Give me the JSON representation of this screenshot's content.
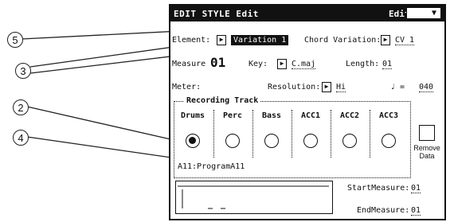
{
  "callouts": [
    "5",
    "3",
    "2",
    "4"
  ],
  "window": {
    "title": "EDIT STYLE Edit",
    "mode_label": "Edit",
    "menu_glyph": "▼"
  },
  "element": {
    "label": "Element:",
    "value": "Variation 1"
  },
  "chord_variation": {
    "label": "Chord Variation:",
    "value": "CV 1"
  },
  "measure": {
    "label": "Measure",
    "value": "01"
  },
  "key": {
    "label": "Key:",
    "value": "C.maj"
  },
  "length": {
    "label": "Length:",
    "value": "01"
  },
  "meter": {
    "label": "Meter:",
    "value": "**/**"
  },
  "resolution": {
    "label": "Resolution:",
    "value": "Hi"
  },
  "tempo": {
    "symbol": "♩ =",
    "value": "040"
  },
  "recording_track": {
    "title": "Recording Track",
    "tracks": [
      {
        "name": "Drums",
        "selected": true
      },
      {
        "name": "Perc",
        "selected": false
      },
      {
        "name": "Bass",
        "selected": false
      },
      {
        "name": "ACC1",
        "selected": false
      },
      {
        "name": "ACC2",
        "selected": false
      },
      {
        "name": "ACC3",
        "selected": false
      }
    ]
  },
  "remove_data": {
    "line1": "Remove",
    "line2": "Data"
  },
  "program": "A11:ProgramA11",
  "start_measure": {
    "label": "StartMeasure:",
    "value": "01"
  },
  "end_measure": {
    "label": "EndMeasure:",
    "value": "01"
  },
  "button_arrow": "▶"
}
